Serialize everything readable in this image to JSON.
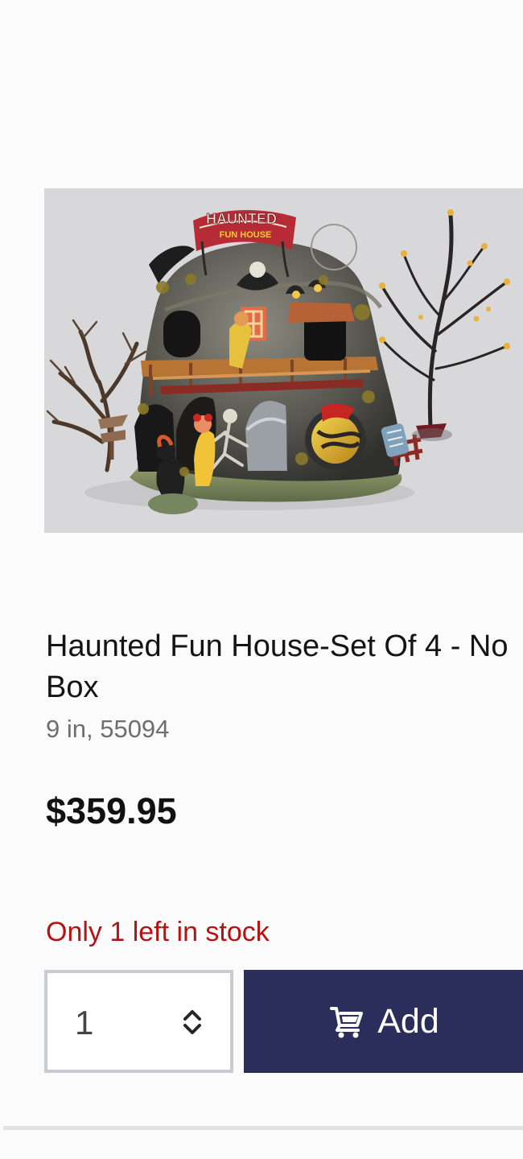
{
  "product": {
    "title": "Haunted Fun House-Set Of 4 - No Box",
    "meta": "9 in, 55094",
    "price": "$359.95",
    "stock_message": "Only 1 left in stock",
    "image_text": {
      "sign_top": "HAUNTED",
      "sign_bottom": "FUN HOUSE"
    }
  },
  "purchase": {
    "quantity": "1",
    "add_label": "Add",
    "add_icon": "cart-icon",
    "stepper_icon": "up-down-chevron-icon"
  },
  "colors": {
    "button_background": "#2b2d5a",
    "stock_text": "#b31313",
    "quantity_border": "#c8cbd1"
  }
}
